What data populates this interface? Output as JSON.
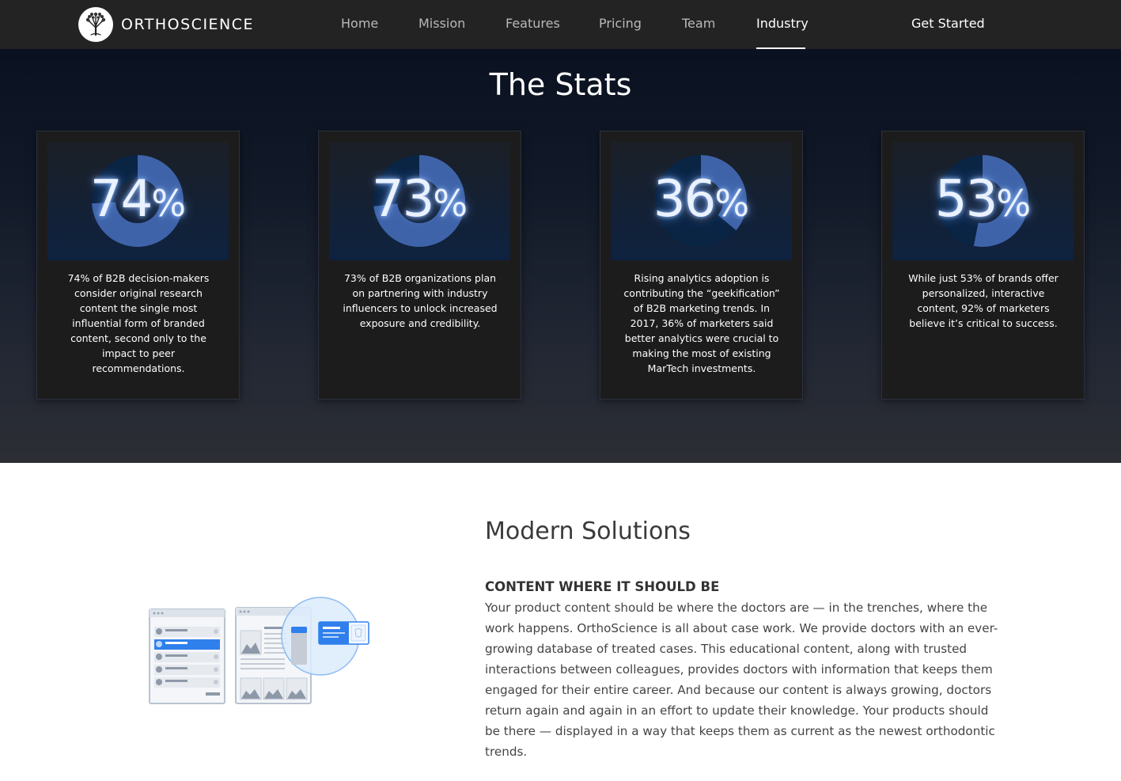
{
  "nav": {
    "brand": "ORTHOSCIENCE",
    "items": [
      "Home",
      "Mission",
      "Features",
      "Pricing",
      "Team",
      "Industry"
    ],
    "active": "Industry",
    "cta": "Get Started"
  },
  "stats": {
    "title": "The Stats",
    "cards": [
      {
        "value": "74",
        "fraction": 0.74,
        "text": "74% of B2B decision-makers consider original research content the single most influential form of branded content, second only to the impact to peer recommendations."
      },
      {
        "value": "73",
        "fraction": 0.73,
        "text": "73% of B2B organizations plan on partnering with industry influencers to unlock increased exposure and credibility."
      },
      {
        "value": "36",
        "fraction": 0.36,
        "text": "Rising analytics adoption is contributing the “geekification” of B2B marketing trends. In 2017, 36% of marketers said better analytics were crucial to making the most of existing MarTech investments."
      },
      {
        "value": "53",
        "fraction": 0.53,
        "text": "While just 53% of brands offer personalized, interactive content, 92% of marketers believe it’s critical to success."
      }
    ],
    "percent_sign": "%"
  },
  "solutions": {
    "heading": "Modern Solutions",
    "subheading": "CONTENT WHERE IT SHOULD BE",
    "paragraph": "Your product content should be where the doctors are — in the trenches, where the work happens.  OrthoScience is all about case work. We provide doctors with an ever-growing database of treated cases. This educational content, along with trusted interactions between colleagues, provides doctors with information that keeps them engaged for their entire career. And because our content is always growing, doctors return again and again in an effort to update their knowledge. Your products should be there — displayed in a way that keeps them as current as the newest orthodontic trends."
  },
  "colors": {
    "nav_bg": "#232323",
    "donut_fill": "#3f63a8",
    "donut_track": "#0a2444",
    "glow": "#9fc3ff",
    "illustration_accent": "#2f80ed"
  }
}
